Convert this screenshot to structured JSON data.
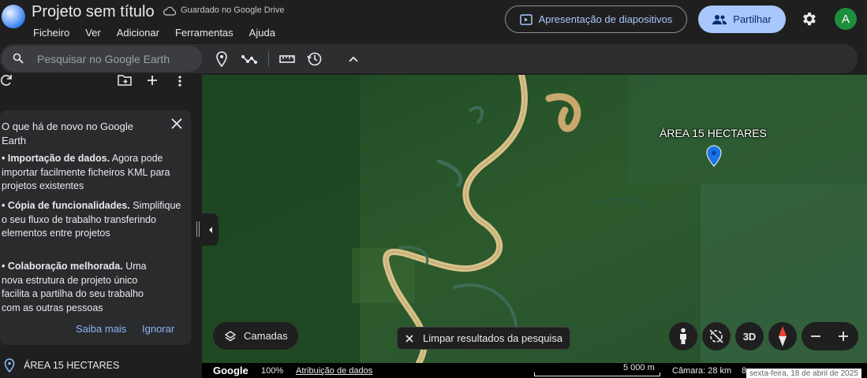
{
  "header": {
    "title": "Projeto sem título",
    "drive_status": "Guardado no Google Drive",
    "menu": [
      "Ficheiro",
      "Ver",
      "Adicionar",
      "Ferramentas",
      "Ajuda"
    ],
    "present_label": "Apresentação de diapositivos",
    "share_label": "Partilhar",
    "avatar_letter": "A"
  },
  "search": {
    "placeholder": "Pesquisar no Google Earth"
  },
  "sidebar": {
    "card": {
      "title": "O que há de novo no Google Earth",
      "items": [
        {
          "bold": "• Importação de dados.",
          "text": " Agora pode importar facilmente ficheiros KML para projetos existentes"
        },
        {
          "bold": "• Cópia de funcionalidades.",
          "text": " Simplifique o seu fluxo de trabalho transferindo elementos entre projetos"
        },
        {
          "bold": "• Colaboração melhorada.",
          "text": " Uma nova estrutura de projeto único facilita a partilha do seu trabalho com as outras pessoas"
        }
      ],
      "learn_more": "Saiba mais",
      "dismiss": "Ignorar"
    },
    "place_label": "ÁREA 15 HECTARES"
  },
  "map": {
    "placemark_label": "ÁREA 15 HECTARES",
    "layers_label": "Camadas",
    "clear_label": "Limpar resultados da pesquisa",
    "btn_3d": "3D",
    "colors": {
      "pin": "#1a73e8",
      "forest": "#2c5a2c",
      "river": "#d9c28a"
    }
  },
  "status": {
    "logo": "Google",
    "zoom": "100%",
    "attribution": "Atribuição de dados",
    "scale": "5 000 m",
    "camera": "Câmara: 28 km",
    "extra": "8",
    "date": "sexta-feira, 18 de abril de 2025"
  }
}
